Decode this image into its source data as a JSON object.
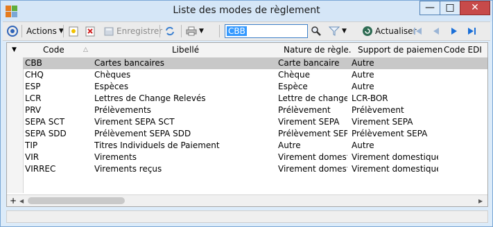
{
  "window": {
    "title": "Liste des modes de règlement"
  },
  "toolbar": {
    "actions_label": "Actions",
    "save_label": "Enregistrer",
    "search_value": "CBB",
    "refresh_label": "Actualiser"
  },
  "grid": {
    "columns": [
      "Code",
      "Libellé",
      "Nature de règle...",
      "Support de paiement",
      "Code EDI"
    ],
    "rows": [
      {
        "code": "CBB",
        "libelle": "Cartes bancaires",
        "nature": "Carte bancaire",
        "support": "Autre",
        "edi": ""
      },
      {
        "code": "CHQ",
        "libelle": "Chèques",
        "nature": "Chèque",
        "support": "Autre",
        "edi": ""
      },
      {
        "code": "ESP",
        "libelle": "Espèces",
        "nature": "Espèce",
        "support": "Autre",
        "edi": ""
      },
      {
        "code": "LCR",
        "libelle": "Lettres de Change Relevés",
        "nature": "Lettre de change re",
        "support": "LCR-BOR",
        "edi": ""
      },
      {
        "code": "PRV",
        "libelle": "Prélèvements",
        "nature": "Prélèvement",
        "support": "Prélèvement",
        "edi": ""
      },
      {
        "code": "SEPA SCT",
        "libelle": "Virement SEPA SCT",
        "nature": "Virement SEPA",
        "support": "Virement SEPA",
        "edi": ""
      },
      {
        "code": "SEPA SDD",
        "libelle": "Prélèvement SEPA SDD",
        "nature": "Prélèvement SEPA",
        "support": "Prélèvement SEPA",
        "edi": ""
      },
      {
        "code": "TIP",
        "libelle": "Titres Individuels de Paiement",
        "nature": "Autre",
        "support": "Autre",
        "edi": ""
      },
      {
        "code": "VIR",
        "libelle": "Virements",
        "nature": "Virement domestiqu",
        "support": "Virement domestique",
        "edi": ""
      },
      {
        "code": "VIRREC",
        "libelle": "Virements reçus",
        "nature": "Virement domestiqu",
        "support": "Virement domestique",
        "edi": ""
      }
    ]
  },
  "scroll": {
    "plus_label": "+"
  },
  "colors": {
    "selected_row": "#c8c8c8",
    "close_button": "#c74a4a",
    "titlebar": "#d5e6f7"
  }
}
